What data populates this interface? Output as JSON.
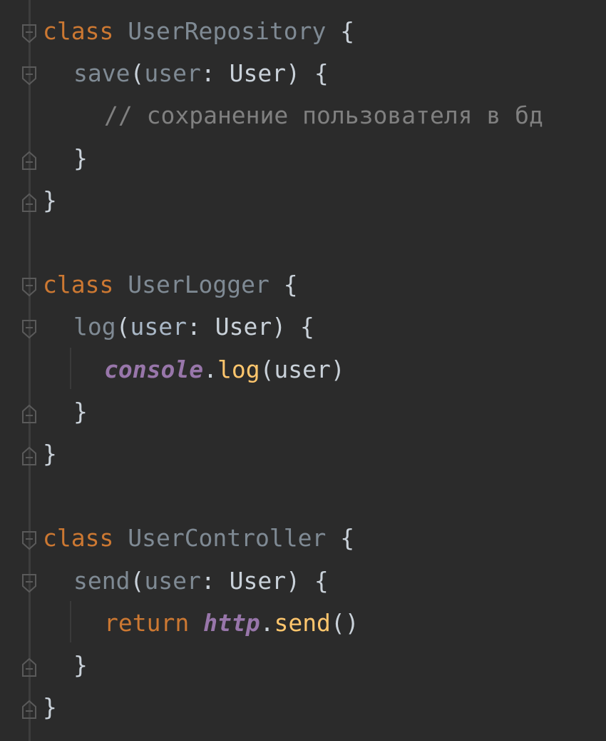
{
  "code": {
    "language": "TypeScript",
    "lines": [
      {
        "tokens": [
          {
            "t": "class",
            "c": "kw"
          },
          {
            "t": " ",
            "c": "punct"
          },
          {
            "t": "UserRepository",
            "c": "cls"
          },
          {
            "t": " {",
            "c": "brace"
          }
        ],
        "indent": 0,
        "fold": "open"
      },
      {
        "tokens": [
          {
            "t": "save",
            "c": "fn"
          },
          {
            "t": "(",
            "c": "punct"
          },
          {
            "t": "user",
            "c": "param"
          },
          {
            "t": ": ",
            "c": "punct"
          },
          {
            "t": "User",
            "c": "type"
          },
          {
            "t": ") {",
            "c": "brace"
          }
        ],
        "indent": 1,
        "fold": "open"
      },
      {
        "tokens": [
          {
            "t": "// сохранение пользователя в бд",
            "c": "comment"
          }
        ],
        "indent": 2,
        "fold": "none"
      },
      {
        "tokens": [
          {
            "t": "}",
            "c": "brace"
          }
        ],
        "indent": 1,
        "fold": "close"
      },
      {
        "tokens": [
          {
            "t": "}",
            "c": "brace"
          }
        ],
        "indent": 0,
        "fold": "close"
      },
      {
        "tokens": [],
        "indent": 0,
        "fold": "none"
      },
      {
        "tokens": [
          {
            "t": "class",
            "c": "kw"
          },
          {
            "t": " ",
            "c": "punct"
          },
          {
            "t": "UserLogger",
            "c": "cls"
          },
          {
            "t": " {",
            "c": "brace"
          }
        ],
        "indent": 0,
        "fold": "open"
      },
      {
        "tokens": [
          {
            "t": "log",
            "c": "fn"
          },
          {
            "t": "(",
            "c": "punct"
          },
          {
            "t": "user",
            "c": "fn-bright"
          },
          {
            "t": ": ",
            "c": "punct"
          },
          {
            "t": "User",
            "c": "type"
          },
          {
            "t": ") {",
            "c": "brace"
          }
        ],
        "indent": 1,
        "fold": "open"
      },
      {
        "tokens": [
          {
            "t": "console",
            "c": "global"
          },
          {
            "t": ".",
            "c": "punct"
          },
          {
            "t": "log",
            "c": "method"
          },
          {
            "t": "(user)",
            "c": "punct"
          }
        ],
        "indent": 2,
        "fold": "none"
      },
      {
        "tokens": [
          {
            "t": "}",
            "c": "brace"
          }
        ],
        "indent": 1,
        "fold": "close"
      },
      {
        "tokens": [
          {
            "t": "}",
            "c": "brace"
          }
        ],
        "indent": 0,
        "fold": "close"
      },
      {
        "tokens": [],
        "indent": 0,
        "fold": "none"
      },
      {
        "tokens": [
          {
            "t": "class",
            "c": "kw"
          },
          {
            "t": " ",
            "c": "punct"
          },
          {
            "t": "UserController",
            "c": "cls"
          },
          {
            "t": " {",
            "c": "brace"
          }
        ],
        "indent": 0,
        "fold": "open"
      },
      {
        "tokens": [
          {
            "t": "send",
            "c": "fn"
          },
          {
            "t": "(",
            "c": "punct"
          },
          {
            "t": "user",
            "c": "param"
          },
          {
            "t": ": ",
            "c": "punct"
          },
          {
            "t": "User",
            "c": "type"
          },
          {
            "t": ") {",
            "c": "brace"
          }
        ],
        "indent": 1,
        "fold": "open"
      },
      {
        "tokens": [
          {
            "t": "return",
            "c": "kw"
          },
          {
            "t": " ",
            "c": "punct"
          },
          {
            "t": "http",
            "c": "global"
          },
          {
            "t": ".",
            "c": "punct"
          },
          {
            "t": "send",
            "c": "method"
          },
          {
            "t": "()",
            "c": "punct"
          }
        ],
        "indent": 2,
        "fold": "none"
      },
      {
        "tokens": [
          {
            "t": "}",
            "c": "brace"
          }
        ],
        "indent": 1,
        "fold": "close"
      },
      {
        "tokens": [
          {
            "t": "}",
            "c": "brace"
          }
        ],
        "indent": 0,
        "fold": "close"
      }
    ]
  },
  "colors": {
    "background": "#2b2b2b",
    "keyword": "#cc7832",
    "comment": "#808080",
    "global": "#9876aa",
    "method": "#ffc66d"
  },
  "icons": {
    "fold_open": "fold-expanded-icon",
    "fold_close": "fold-end-icon"
  }
}
